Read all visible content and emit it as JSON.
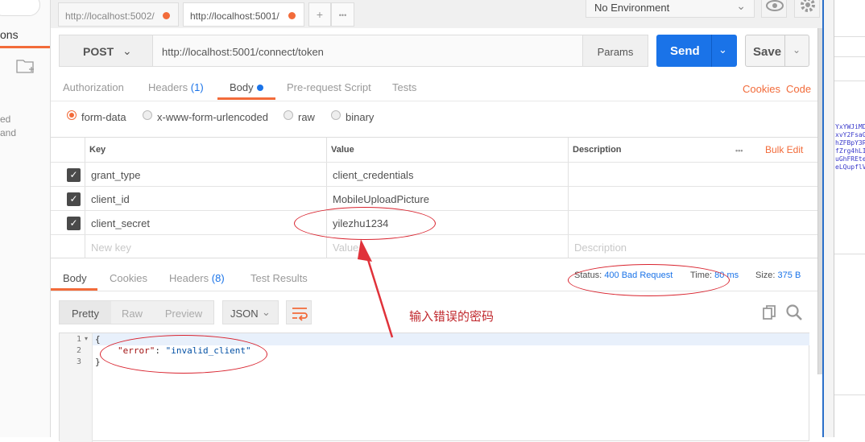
{
  "sidebar": {
    "section_label": "ons",
    "desc_line1": "ed",
    "desc_line2": "and"
  },
  "tabs": [
    {
      "label": "http://localhost:5002/"
    },
    {
      "label": "http://localhost:5001/"
    }
  ],
  "tab_controls": {
    "add": "+",
    "more": "•••"
  },
  "environment": {
    "label": "No Environment"
  },
  "request": {
    "method": "POST",
    "url": "http://localhost:5001/connect/token",
    "params_label": "Params",
    "send_label": "Send",
    "save_label": "Save"
  },
  "request_tabs": {
    "authorization": "Authorization",
    "headers": "Headers",
    "headers_count": "(1)",
    "body": "Body",
    "prerequest": "Pre-request Script",
    "tests": "Tests",
    "cookies": "Cookies",
    "code": "Code"
  },
  "body_modes": {
    "form_data": "form-data",
    "urlencoded": "x-www-form-urlencoded",
    "raw": "raw",
    "binary": "binary"
  },
  "params_table": {
    "headers": {
      "key": "Key",
      "value": "Value",
      "description": "Description",
      "more": "•••",
      "bulk_edit": "Bulk Edit"
    },
    "rows": [
      {
        "key": "grant_type",
        "value": "client_credentials"
      },
      {
        "key": "client_id",
        "value": "MobileUploadPicture"
      },
      {
        "key": "client_secret",
        "value": "yilezhu1234"
      }
    ],
    "placeholders": {
      "key": "New key",
      "value": "Value",
      "description": "Description"
    }
  },
  "response": {
    "tabs": {
      "body": "Body",
      "cookies": "Cookies",
      "headers": "Headers",
      "headers_count": "(8)",
      "tests": "Test Results"
    },
    "status_label": "Status:",
    "status": "400 Bad Request",
    "time_label": "Time:",
    "time": "80 ms",
    "size_label": "Size:",
    "size": "375 B",
    "format_buttons": {
      "pretty": "Pretty",
      "raw": "Raw",
      "preview": "Preview"
    },
    "language": "JSON",
    "lines": [
      "1",
      "2",
      "3"
    ],
    "code": {
      "open": "{",
      "key": "\"error\"",
      "colon": ": ",
      "value": "\"invalid_client\"",
      "close": "}"
    }
  },
  "annotation": {
    "note": "输入错误的密码"
  },
  "right_strip": {
    "text": "YxYWJiMD\nxvY2FsaG\nhZFBpY3R\nfZrg4hLI\nuGhFREte\neLQupflV"
  },
  "colors": {
    "accent": "#f26b3a",
    "primary": "#1a73e8",
    "annotation": "#d9232e"
  }
}
